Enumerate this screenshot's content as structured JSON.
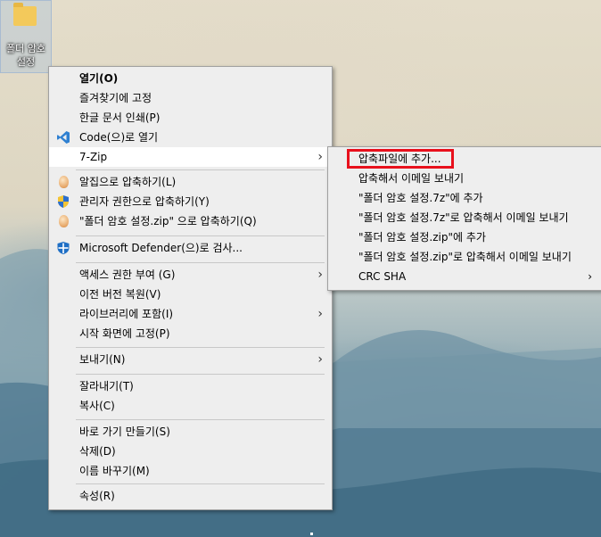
{
  "desktop": {
    "icon_label_line1": "폴더 암호",
    "icon_label_line2": "설정"
  },
  "context_menu": {
    "open": "열기(O)",
    "pin_quick_access": "즐겨찾기에 고정",
    "hangul_print": "한글 문서 인쇄(P)",
    "open_with_code": "Code(으)로 열기",
    "seven_zip": "7-Zip",
    "alzip_compress": "알집으로 압축하기(L)",
    "admin_compress": "관리자 권한으로 압축하기(Y)",
    "compress_named": "\"폴더 암호 설정.zip\" 으로 압축하기(Q)",
    "defender_scan": "Microsoft Defender(으)로 검사...",
    "give_access": "액세스 권한 부여 (G)",
    "restore_previous": "이전 버전 복원(V)",
    "include_library": "라이브러리에 포함(I)",
    "pin_start": "시작 화면에 고정(P)",
    "send_to": "보내기(N)",
    "cut": "잘라내기(T)",
    "copy": "복사(C)",
    "create_shortcut": "바로 가기 만들기(S)",
    "delete": "삭제(D)",
    "rename": "이름 바꾸기(M)",
    "properties": "속성(R)"
  },
  "seven_zip_submenu": {
    "add_to_archive": "압축파일에 추가...",
    "compress_email": "압축해서 이메일 보내기",
    "add_7z": "\"폴더 암호 설정.7z\"에 추가",
    "add_7z_email": "\"폴더 암호 설정.7z\"로 압축해서 이메일 보내기",
    "add_zip": "\"폴더 암호 설정.zip\"에 추가",
    "add_zip_email": "\"폴더 암호 설정.zip\"로 압축해서 이메일 보내기",
    "crc_sha": "CRC SHA"
  },
  "colors": {
    "menu_bg": "#eeeeee",
    "highlight_box": "#e8101c",
    "vscode_blue": "#2f80d1",
    "defender_blue": "#1f6fc5"
  }
}
